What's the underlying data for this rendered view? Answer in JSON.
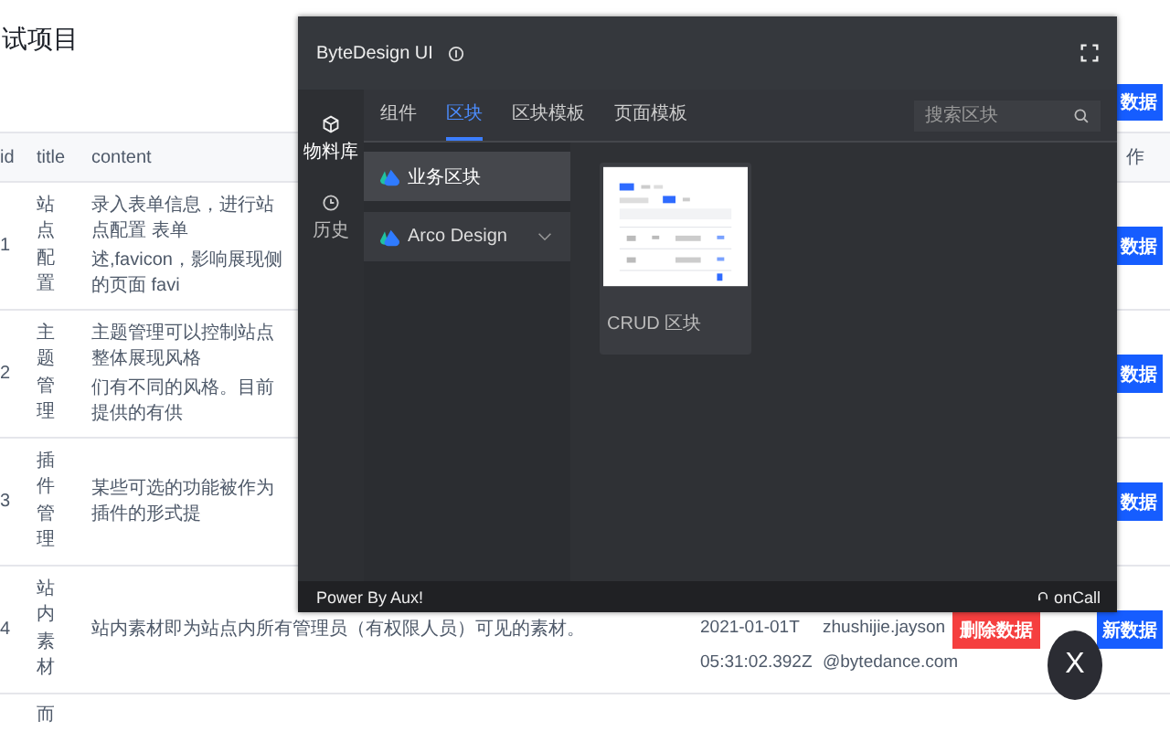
{
  "page": {
    "title": "试项目",
    "toolbar_button": "数据"
  },
  "table": {
    "columns": [
      "id",
      "title",
      "content",
      "作"
    ],
    "rows": [
      {
        "id": "1",
        "title": "站点配置",
        "content": [
          "录入表单信息，进行站点配置 表单",
          "述,favicon，影响展现侧的页面 favi"
        ],
        "actions": [
          {
            "kind": "primary",
            "label": "数据"
          }
        ]
      },
      {
        "id": "2",
        "title": "主题管理",
        "content": [
          "主题管理可以控制站点整体展现风格",
          "们有不同的风格。目前提供的有供"
        ],
        "actions": [
          {
            "kind": "primary",
            "label": "数据"
          }
        ]
      },
      {
        "id": "3",
        "title": "插件管理",
        "content": [
          "某些可选的功能被作为插件的形式提"
        ],
        "actions": [
          {
            "kind": "primary",
            "label": "数据"
          }
        ]
      },
      {
        "id": "4",
        "title": "站内素材",
        "content": [
          "站内素材即为站点内所有管理员（有权限人员）可见的素材。"
        ],
        "created": [
          "2021-01-01T",
          "05:31:02.392Z"
        ],
        "creator": [
          "zhushijie.jayson",
          "@bytedance.com"
        ],
        "actions": [
          {
            "kind": "danger",
            "label": "删除数据"
          },
          {
            "kind": "primary",
            "label": "新数据"
          }
        ]
      },
      {
        "title": "而",
        "content": [],
        "actions": []
      }
    ]
  },
  "panel": {
    "title": "ByteDesign UI",
    "nav": [
      {
        "label": "物料库",
        "selected": true
      },
      {
        "label": "历史",
        "selected": false
      }
    ],
    "tabs": [
      {
        "label": "组件",
        "selected": false
      },
      {
        "label": "区块",
        "selected": true
      },
      {
        "label": "区块模板",
        "selected": false
      },
      {
        "label": "页面模板",
        "selected": false
      }
    ],
    "search": {
      "placeholder": "搜索区块"
    },
    "categories": [
      {
        "label": "业务区块",
        "selected": true,
        "expandable": false
      },
      {
        "label": "Arco Design",
        "selected": false,
        "expandable": true
      }
    ],
    "cards": [
      {
        "caption": "CRUD 区块"
      }
    ],
    "footer": {
      "left": "Power By Aux!",
      "right": "onCall"
    }
  },
  "close_button": {
    "label": "X"
  }
}
